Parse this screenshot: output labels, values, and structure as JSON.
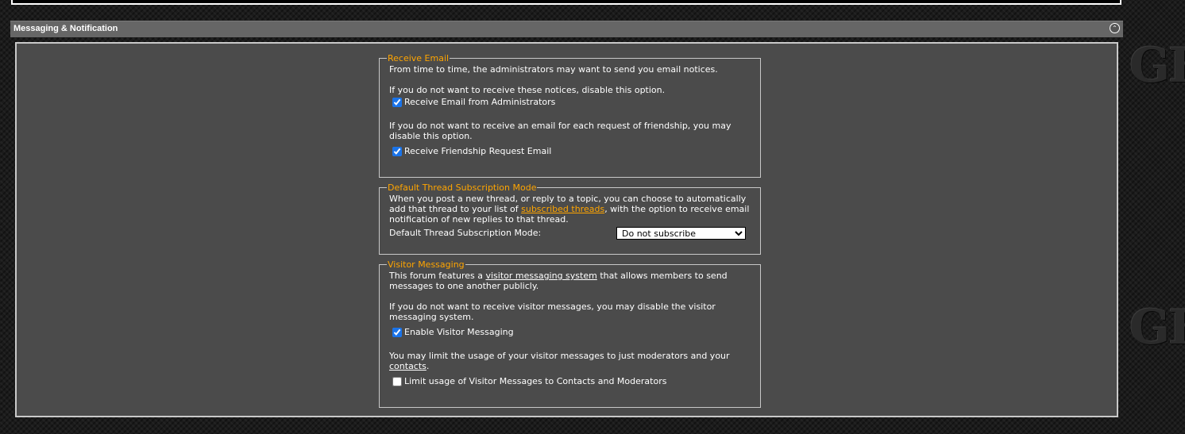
{
  "watermark": "GF",
  "section": {
    "title": "Messaging & Notification"
  },
  "receive_email": {
    "legend": "Receive Email",
    "intro": "From time to time, the administrators may want to send you email notices.",
    "disable_text": "If you do not want to receive these notices, disable this option.",
    "admin_checkbox_label": "Receive Email from Administrators",
    "admin_checked": true,
    "friendship_text": "If you do not want to receive an email for each request of friendship, you may disable this option.",
    "friendship_checkbox_label": "Receive Friendship Request Email",
    "friendship_checked": true
  },
  "subscription": {
    "legend": "Default Thread Subscription Mode",
    "text_before": "When you post a new thread, or reply to a topic, you can choose to automatically add that thread to your list of ",
    "link": "subscribed threads",
    "text_after": ", with the option to receive email notification of new replies to that thread.",
    "mode_label": "Default Thread Subscription Mode:",
    "selected": "Do not subscribe"
  },
  "visitor_messaging": {
    "legend": "Visitor Messaging",
    "text_before": "This forum features a ",
    "link": "visitor messaging system",
    "text_after": " that allows members to send messages to one another publicly.",
    "disable_text": "If you do not want to receive visitor messages, you may disable the visitor messaging system.",
    "enable_checkbox_label": "Enable Visitor Messaging",
    "enable_checked": true,
    "limit_text_before": "You may limit the usage of your visitor messages to just moderators and your ",
    "limit_link": "contacts",
    "limit_text_after": ".",
    "limit_checkbox_label": "Limit usage of Visitor Messages to Contacts and Moderators",
    "limit_checked": false
  },
  "colors": {
    "legend": "#ffa500",
    "panel": "#4b4b4b",
    "header": "#666666"
  }
}
